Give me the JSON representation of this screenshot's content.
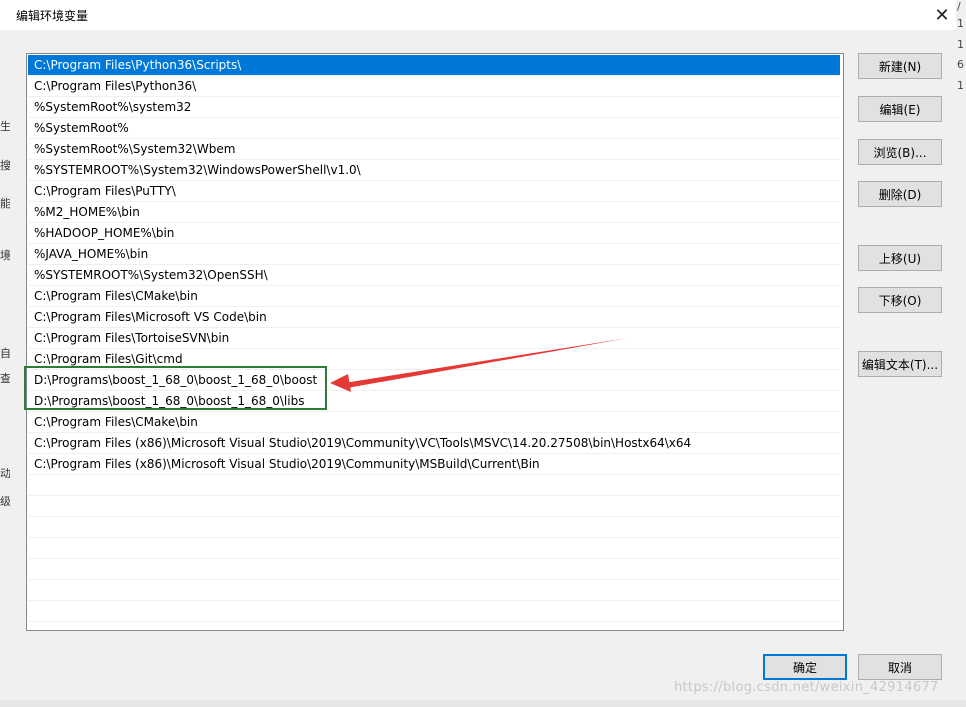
{
  "dialog": {
    "title": "编辑环境变量",
    "close_glyph": "✕"
  },
  "path_list": {
    "items": [
      "C:\\Program Files\\Python36\\Scripts\\",
      "C:\\Program Files\\Python36\\",
      "%SystemRoot%\\system32",
      "%SystemRoot%",
      "%SystemRoot%\\System32\\Wbem",
      "%SYSTEMROOT%\\System32\\WindowsPowerShell\\v1.0\\",
      "C:\\Program Files\\PuTTY\\",
      "%M2_HOME%\\bin",
      "%HADOOP_HOME%\\bin",
      "%JAVA_HOME%\\bin",
      "%SYSTEMROOT%\\System32\\OpenSSH\\",
      "C:\\Program Files\\CMake\\bin",
      "C:\\Program Files\\Microsoft VS Code\\bin",
      "C:\\Program Files\\TortoiseSVN\\bin",
      "C:\\Program Files\\Git\\cmd",
      "D:\\Programs\\boost_1_68_0\\boost_1_68_0\\boost",
      "D:\\Programs\\boost_1_68_0\\boost_1_68_0\\libs",
      "C:\\Program Files\\CMake\\bin",
      "C:\\Program Files (x86)\\Microsoft Visual Studio\\2019\\Community\\VC\\Tools\\MSVC\\14.20.27508\\bin\\Hostx64\\x64",
      "C:\\Program Files (x86)\\Microsoft Visual Studio\\2019\\Community\\MSBuild\\Current\\Bin"
    ],
    "selected_index": 0,
    "empty_rows": 8
  },
  "buttons": {
    "new": "新建(N)",
    "edit": "编辑(E)",
    "browse": "浏览(B)...",
    "delete": "删除(D)",
    "move_up": "上移(U)",
    "move_down": "下移(O)",
    "edit_text": "编辑文本(T)...",
    "ok": "确定",
    "cancel": "取消"
  },
  "annotation": {
    "box_color": "#2e7d32",
    "arrow_color": "#e53935"
  },
  "watermark": "https://blog.csdn.net/weixin_42914677",
  "colors": {
    "selection": "#0078d7",
    "dialog_bg": "#f0f0f0",
    "button_bg": "#e1e1e1"
  },
  "background_fragments": {
    "left": [
      "生",
      "搜",
      "能",
      "境",
      "自",
      "查",
      "动",
      "级"
    ],
    "right": [
      "/",
      "1",
      "1",
      "6",
      "1"
    ]
  }
}
